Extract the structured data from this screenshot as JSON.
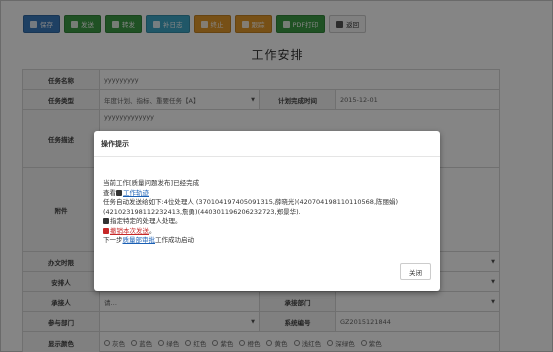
{
  "toolbar": {
    "buttons": [
      {
        "label": "保存",
        "color": "#3a7bbf"
      },
      {
        "label": "发送",
        "color": "#3c9c46"
      },
      {
        "label": "转发",
        "color": "#3c9c46"
      },
      {
        "label": "补日志",
        "color": "#3fa8c8"
      },
      {
        "label": "终止",
        "color": "#e59a2b"
      },
      {
        "label": "跟踪",
        "color": "#e59a2b"
      },
      {
        "label": "PDF打印",
        "color": "#3c9c46"
      },
      {
        "label": "返回",
        "color": "#f5f5f5"
      }
    ]
  },
  "page_title": "工作安排",
  "form": {
    "task_name_label": "任务名称",
    "task_name_value": "yyyyyyyyy",
    "task_type_label": "任务类型",
    "task_type_value": "年度计划、指标、重要任务【A】",
    "plan_time_label": "计划完成时间",
    "plan_time_value": "2015-12-01",
    "desc_label": "任务描述",
    "desc_value": "yyyyyyyyyyyyy",
    "attach_label": "附件",
    "office_label": "办文时限",
    "arrange_label": "安排人",
    "receiver_label": "承接人",
    "receiver_value": "请…",
    "receiver_dept_label": "承接部门",
    "participate_label": "参与部门",
    "system_no_label": "系统编号",
    "system_no_value": "GZ2015121844",
    "color_label": "显示颜色",
    "colors": [
      "灰色",
      "蓝色",
      "绿色",
      "红色",
      "紫色",
      "橙色",
      "黄色",
      "浅红色",
      "深绿色",
      "紫色"
    ]
  },
  "modal": {
    "title": "操作提示",
    "line1": "当前工作[质量问题发布]已经完成",
    "line2_prefix": "查看",
    "line2_link": "工作轨迹",
    "line3": "任务自动发送给如下:4位处理人 (370104197405091315,薛晓光)(420704198110110568,陈丽娟)",
    "line4": "(421023198112232413,詹勇)(440301196206232723,郑景华).",
    "line5": "指定特定的处理人处理。",
    "line6_link": "撤销本次发送",
    "line6_suffix": "。",
    "line7_prefix": "下一步",
    "line7_link": "质量部审批",
    "line7_suffix": "工作成功启动",
    "close_label": "关闭"
  }
}
